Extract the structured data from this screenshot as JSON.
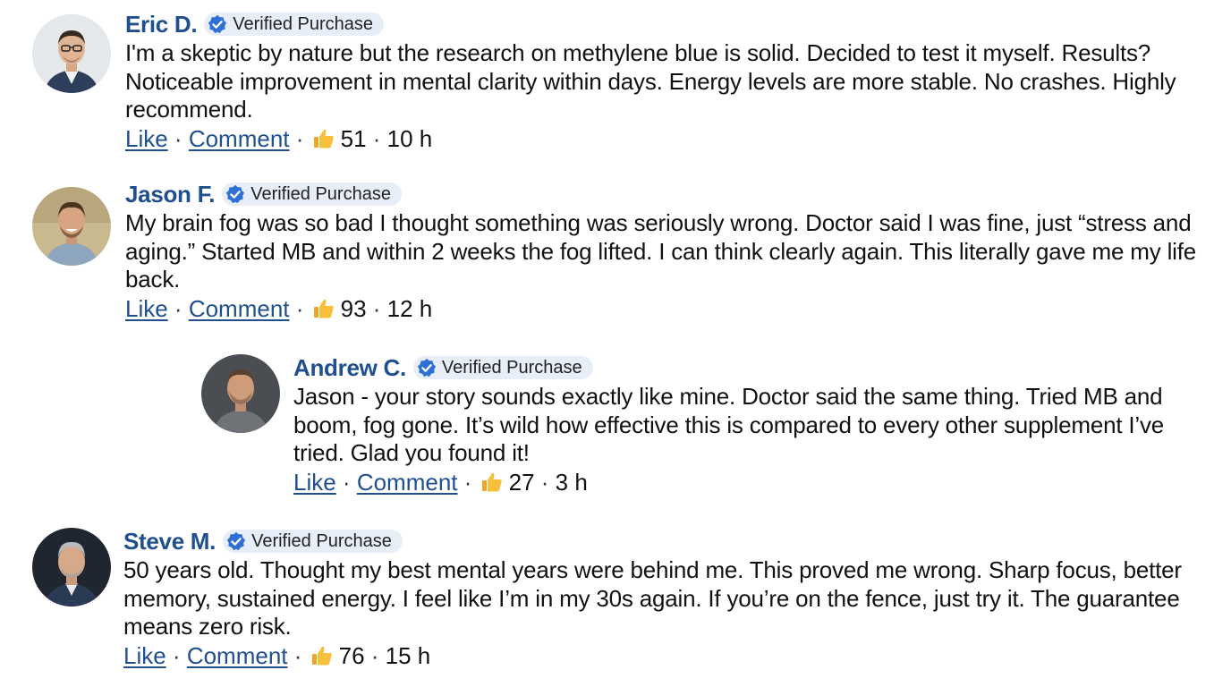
{
  "badge_label": "Verified Purchase",
  "actions": {
    "like": "Like",
    "comment": "Comment",
    "sep": " · "
  },
  "colors": {
    "name": "#1f4f8f",
    "badge_bg": "#e7eef8",
    "check": "#2f6fd6"
  },
  "comments": [
    {
      "name": "Eric D.",
      "text": "I'm a skeptic by nature but the research on methylene blue is solid. Decided to test it myself. Results? Noticeable improvement in mental clarity within days. Energy levels are more stable. No crashes. Highly recommend.",
      "likes": "51",
      "time": "10 h"
    },
    {
      "name": "Jason F.",
      "text": "My brain fog was so bad I thought something was seriously wrong. Doctor said I was fine, just “stress and aging.” Started MB and within 2 weeks the fog lifted. I can think clearly again. This literally gave me my life back.",
      "likes": "93",
      "time": "12 h"
    },
    {
      "name": "Andrew C.",
      "text": "Jason - your story sounds exactly like mine. Doctor said the same thing. Tried MB and boom, fog gone. It’s wild how effective this is compared to every other supplement I’ve tried. Glad you found it!",
      "likes": "27",
      "time": "3 h"
    },
    {
      "name": "Steve M.",
      "text": "50 years old. Thought my best mental years were behind me. This proved me wrong. Sharp focus, better memory, sustained energy. I feel like I’m in my 30s again. If you’re on the fence, just try it. The guarantee means zero risk.",
      "likes": "76",
      "time": "15 h"
    }
  ]
}
